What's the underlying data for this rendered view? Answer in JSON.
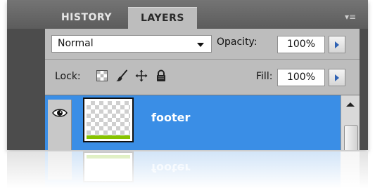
{
  "panel": {
    "tabs": [
      {
        "label": "HISTORY",
        "active": false
      },
      {
        "label": "LAYERS",
        "active": true
      }
    ],
    "menu_icon": "panel-menu-icon"
  },
  "blend": {
    "mode": "Normal",
    "opacity_label": "Opacity:",
    "opacity_value": "100%"
  },
  "lock": {
    "label": "Lock:",
    "icons": [
      "lock-transparent-pixels-icon",
      "lock-image-pixels-icon",
      "lock-position-icon",
      "lock-all-icon"
    ],
    "fill_label": "Fill:",
    "fill_value": "100%"
  },
  "layers": [
    {
      "name": "footer",
      "visible": true,
      "selected": true
    }
  ],
  "colors": {
    "panel_dark": "#4c4c4c",
    "panel_light": "#bdbdbd",
    "selection": "#3a8ee6",
    "thumb_bar": "#86c300",
    "stepper_arrow": "#2f62b3"
  }
}
